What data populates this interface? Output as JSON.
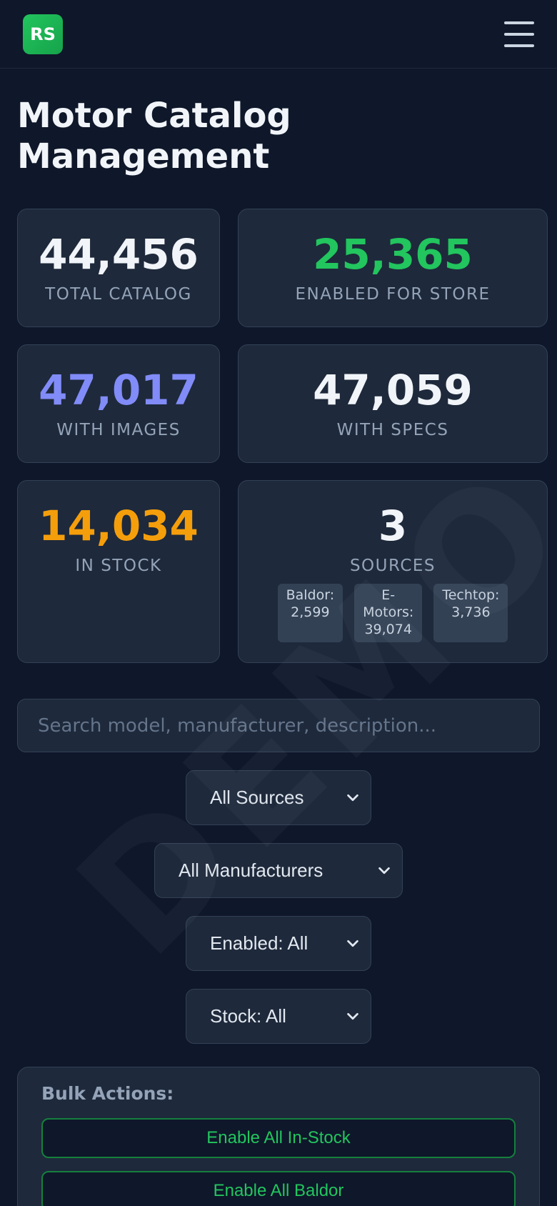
{
  "header": {
    "logo_text": "RS",
    "menu_icon": "hamburger-menu-icon"
  },
  "page": {
    "title": "Motor Catalog Management"
  },
  "stats": {
    "total_catalog": {
      "value": "44,456",
      "label": "TOTAL CATALOG",
      "color": "#f1f5f9"
    },
    "enabled_for_store": {
      "value": "25,365",
      "label": "ENABLED FOR STORE",
      "color": "#22c55e"
    },
    "with_images": {
      "value": "47,017",
      "label": "WITH IMAGES",
      "color": "#818cf8"
    },
    "with_specs": {
      "value": "47,059",
      "label": "WITH SPECS",
      "color": "#f1f5f9"
    },
    "in_stock": {
      "value": "14,034",
      "label": "IN STOCK",
      "color": "#f59e0b"
    },
    "sources": {
      "value": "3",
      "label": "SOURCES",
      "items": [
        {
          "line1": "Baldor:",
          "line2": "2,599"
        },
        {
          "line1": "E-",
          "line2": "Motors:",
          "line3": "39,074"
        },
        {
          "line1": "Techtop:",
          "line2": "3,736"
        }
      ]
    }
  },
  "search": {
    "placeholder": "Search model, manufacturer, description...",
    "value": ""
  },
  "filters": {
    "source": {
      "selected": "All Sources"
    },
    "manufacturer": {
      "selected": "All Manufacturers"
    },
    "enabled": {
      "selected": "Enabled: All"
    },
    "stock": {
      "selected": "Stock: All"
    }
  },
  "bulk_actions": {
    "title": "Bulk Actions:",
    "buttons": [
      "Enable All In-Stock",
      "Enable All Baldor"
    ]
  },
  "watermark": "DEMO"
}
